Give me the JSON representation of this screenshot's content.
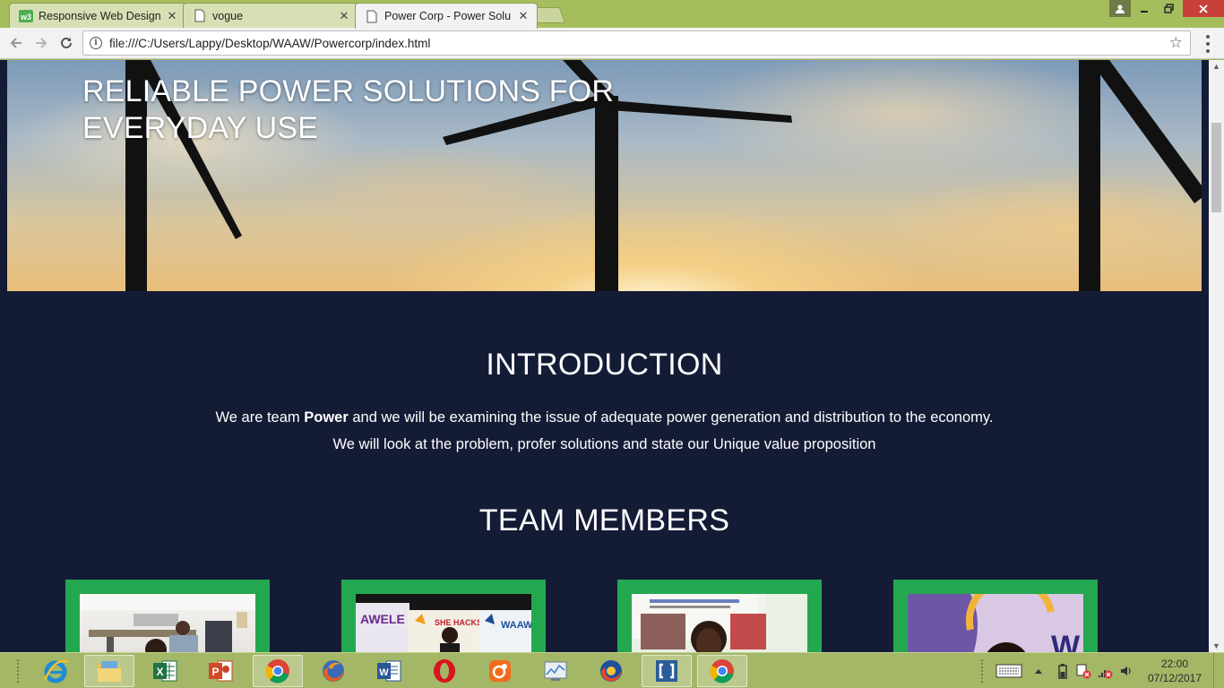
{
  "browser": {
    "tabs": [
      {
        "title": "Responsive Web Design",
        "favicon": "w3-icon",
        "active": false
      },
      {
        "title": "vogue",
        "favicon": "page-icon",
        "active": false
      },
      {
        "title": "Power Corp - Power Solu",
        "favicon": "page-icon",
        "active": true
      }
    ],
    "tab_close": "✕",
    "address": "file:///C:/Users/Lappy/Desktop/WAAW/Powercorp/index.html",
    "icons": {
      "back": "back-arrow-icon",
      "forward": "forward-arrow-icon",
      "reload": "reload-icon",
      "info": "info-icon",
      "bookmark": "star-icon",
      "menu": "menu-dots-icon"
    }
  },
  "page": {
    "hero_title": "RELIABLE POWER SOLUTIONS FOR EVERYDAY USE",
    "intro": {
      "heading": "INTRODUCTION",
      "line1_before": "We are team",
      "line1_bold": "Power",
      "line1_after": "and we will be examining the issue of adequate power generation and distribution to the economy.",
      "line2": "We will look at the problem, profer solutions and state our Unique value proposition"
    },
    "team": {
      "heading": "TEAM MEMBERS",
      "members": [
        {
          "photo": "member-photo-1"
        },
        {
          "photo": "member-photo-2",
          "banner_text": [
            "AWELE",
            "SHE HACKS AFRICA",
            "WAAW"
          ]
        },
        {
          "photo": "member-photo-3"
        },
        {
          "photo": "member-photo-4",
          "banner_text": [
            "W"
          ]
        }
      ]
    },
    "colors": {
      "background": "#141b35",
      "member_frame": "#23a84f",
      "text": "#ffffff"
    }
  },
  "taskbar": {
    "apps": [
      "internet-explorer-icon",
      "file-explorer-icon",
      "excel-icon",
      "powerpoint-icon",
      "chrome-icon",
      "firefox-icon",
      "word-icon",
      "opera-icon",
      "uc-browser-icon",
      "system-monitor-icon",
      "firefox-developer-icon",
      "brackets-icon",
      "chrome-icon"
    ],
    "clock_time": "22:00",
    "clock_date": "07/12/2017"
  }
}
